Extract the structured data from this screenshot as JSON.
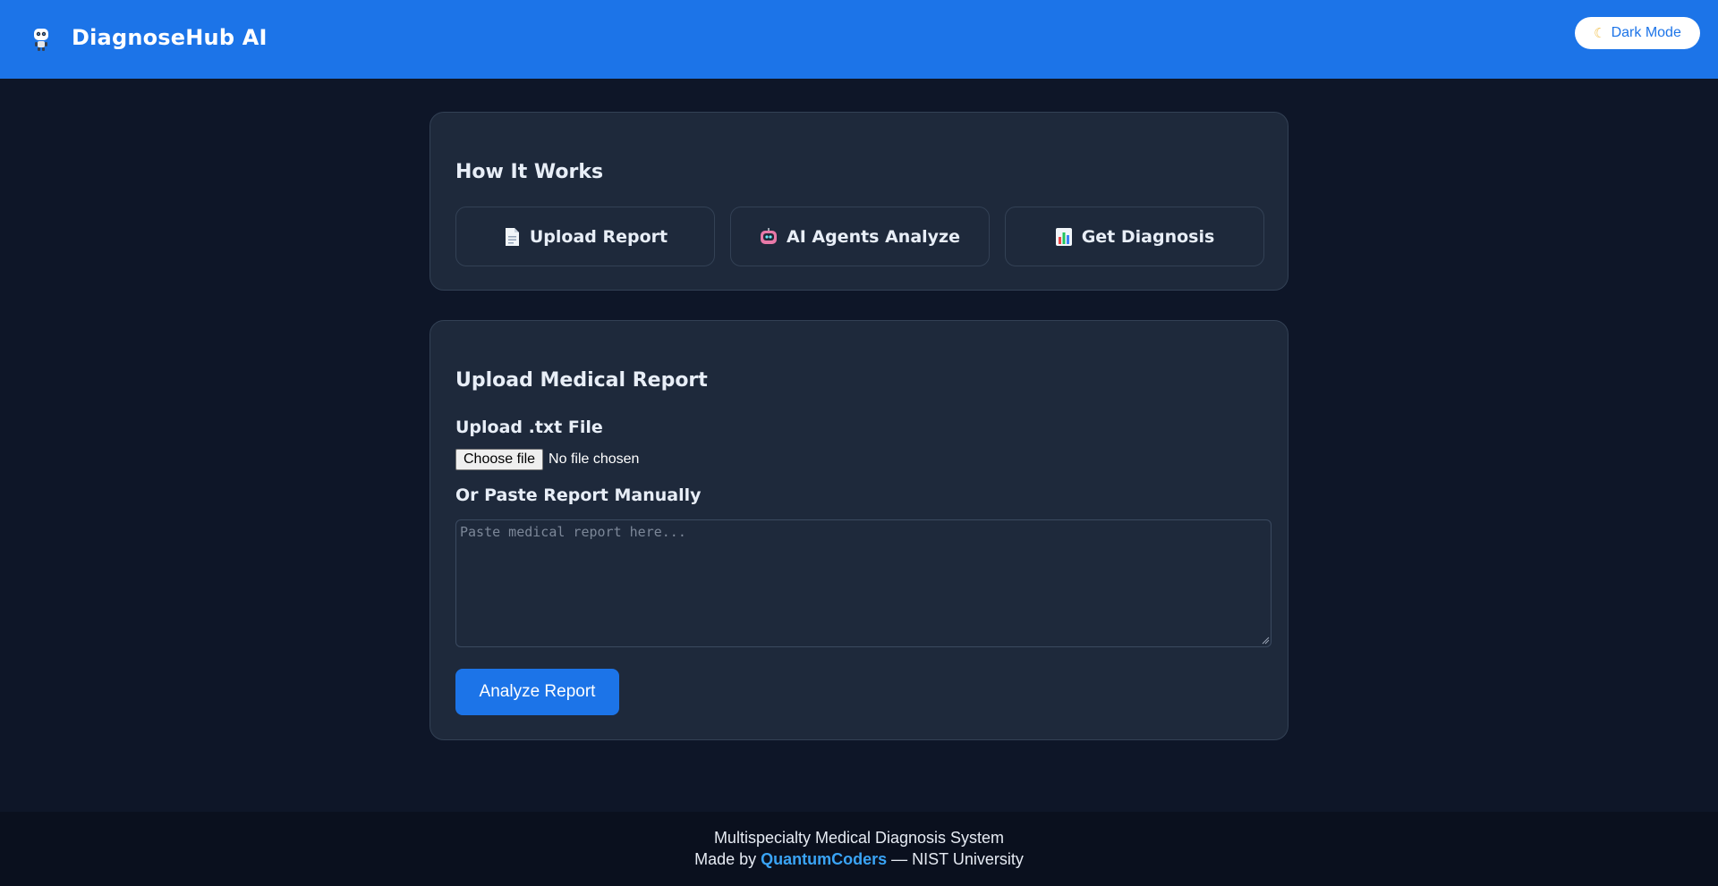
{
  "header": {
    "title": "DiagnoseHub AI",
    "logo_icon": "robot-icon",
    "dark_mode_icon": "moon-icon",
    "dark_mode_label": "Dark Mode",
    "background_color": "#1c74e8"
  },
  "how_it_works": {
    "title": "How It Works",
    "steps": [
      {
        "icon": "document-icon",
        "label": "Upload Report"
      },
      {
        "icon": "robot-icon",
        "label": "AI Agents Analyze"
      },
      {
        "icon": "bar-chart-icon",
        "label": "Get Diagnosis"
      }
    ]
  },
  "upload": {
    "title": "Upload Medical Report",
    "file_label": "Upload .txt File",
    "choose_file_label": "Choose file",
    "file_status": "No file chosen",
    "paste_label": "Or Paste Report Manually",
    "textarea_placeholder": "Paste medical report here...",
    "textarea_value": "",
    "analyze_label": "Analyze Report"
  },
  "footer": {
    "line1": "Multispecialty Medical Diagnosis System",
    "made_by_prefix": "Made by ",
    "brand": "QuantumCoders",
    "suffix": " — NIST University",
    "brand_color": "#3aa4f5"
  },
  "colors": {
    "page_background": "#0e1628",
    "card_background": "#1e293b",
    "accent": "#1c74e8"
  }
}
